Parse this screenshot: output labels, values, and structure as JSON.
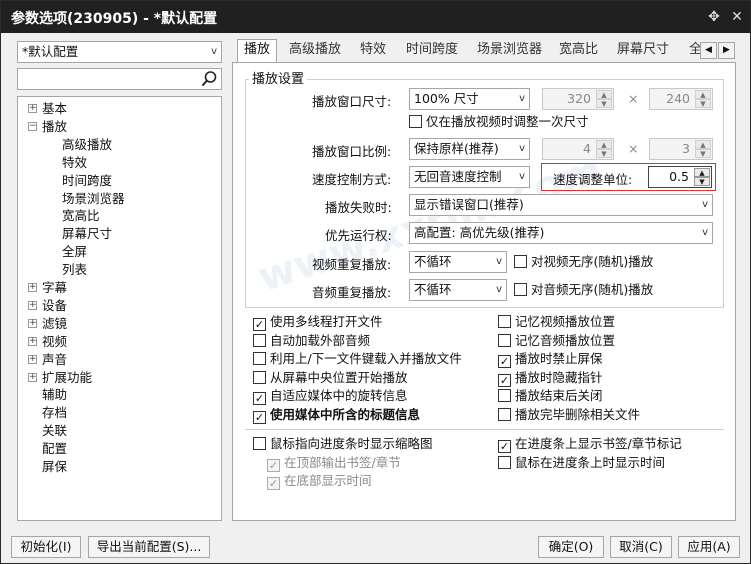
{
  "window": {
    "title": "参数选项(230905) - *默认配置"
  },
  "profile": {
    "selected": "*默认配置"
  },
  "search": {
    "placeholder": ""
  },
  "tree": {
    "items": [
      {
        "label": "基本",
        "expander": "+"
      },
      {
        "label": "播放",
        "expander": "−"
      },
      {
        "label": "高级播放"
      },
      {
        "label": "特效"
      },
      {
        "label": "时间跨度"
      },
      {
        "label": "场景浏览器"
      },
      {
        "label": "宽高比"
      },
      {
        "label": "屏幕尺寸"
      },
      {
        "label": "全屏"
      },
      {
        "label": "列表"
      },
      {
        "label": "字幕",
        "expander": "+"
      },
      {
        "label": "设备",
        "expander": "+"
      },
      {
        "label": "滤镜",
        "expander": "+"
      },
      {
        "label": "视频",
        "expander": "+"
      },
      {
        "label": "声音",
        "expander": "+"
      },
      {
        "label": "扩展功能",
        "expander": "+"
      },
      {
        "label": "辅助"
      },
      {
        "label": "存档"
      },
      {
        "label": "关联"
      },
      {
        "label": "配置"
      },
      {
        "label": "屏保"
      }
    ]
  },
  "tabs": [
    "播放",
    "高级播放",
    "特效",
    "时间跨度",
    "场景浏览器",
    "宽高比",
    "屏幕尺寸",
    "全"
  ],
  "group": {
    "title": "播放设置"
  },
  "form": {
    "window_size_label": "播放窗口尺寸:",
    "window_size_value": "100% 尺寸",
    "width_value": "320",
    "height_value": "240",
    "times_sign": "×",
    "adjust_once_label": "仅在播放视频时调整一次尺寸",
    "ratio_label": "播放窗口比例:",
    "ratio_value": "保持原样(推荐)",
    "ratio_w": "4",
    "ratio_h": "3",
    "speed_mode_label": "速度控制方式:",
    "speed_mode_value": "无回音速度控制",
    "speed_unit_label": "速度调整单位:",
    "speed_unit_value": "0.5",
    "fail_label": "播放失败时:",
    "fail_value": "显示错误窗口(推荐)",
    "priority_label": "优先运行权:",
    "priority_value": "高配置: 高优先级(推荐)",
    "video_repeat_label": "视频重复播放:",
    "video_repeat_value": "不循环",
    "video_shuffle_label": "对视频无序(随机)播放",
    "audio_repeat_label": "音频重复播放:",
    "audio_repeat_value": "不循环",
    "audio_shuffle_label": "对音频无序(随机)播放"
  },
  "options_left": [
    {
      "label": "使用多线程打开文件",
      "checked": true
    },
    {
      "label": "自动加载外部音频",
      "checked": false
    },
    {
      "label": "利用上/下一文件键载入并播放文件",
      "checked": false
    },
    {
      "label": "从屏幕中央位置开始播放",
      "checked": false
    },
    {
      "label": "自适应媒体中的旋转信息",
      "checked": true
    },
    {
      "label": "使用媒体中所含的标题信息",
      "checked": true
    }
  ],
  "options_right": [
    {
      "label": "记忆视频播放位置",
      "checked": false
    },
    {
      "label": "记忆音频播放位置",
      "checked": false
    },
    {
      "label": "播放时禁止屏保",
      "checked": true
    },
    {
      "label": "播放时隐藏指针",
      "checked": true
    },
    {
      "label": "播放结束后关闭",
      "checked": false
    },
    {
      "label": "播放完毕删除相关文件",
      "checked": false
    }
  ],
  "seek_left": [
    {
      "label": "鼠标指向进度条时显示缩略图",
      "checked": false
    },
    {
      "label": "在顶部输出书签/章节",
      "checked": true
    },
    {
      "label": "在底部显示时间",
      "checked": true
    }
  ],
  "seek_right": [
    {
      "label": "在进度条上显示书签/章节标记",
      "checked": true
    },
    {
      "label": "鼠标在进度条上时显示时间",
      "checked": false
    }
  ],
  "buttons": {
    "init": "初始化(I)",
    "export": "导出当前配置(S)...",
    "ok": "确定(O)",
    "cancel": "取消(C)",
    "apply": "应用(A)"
  },
  "glyphs": {
    "combo_arrow": "v",
    "check": "✓",
    "spin_up": "▲",
    "spin_down": "▼",
    "tab_left": "◀",
    "tab_right": "▶",
    "pin": "✥",
    "close": "✕"
  },
  "colors": {
    "highlight": "#e0322f",
    "titlebar": "#202020"
  }
}
